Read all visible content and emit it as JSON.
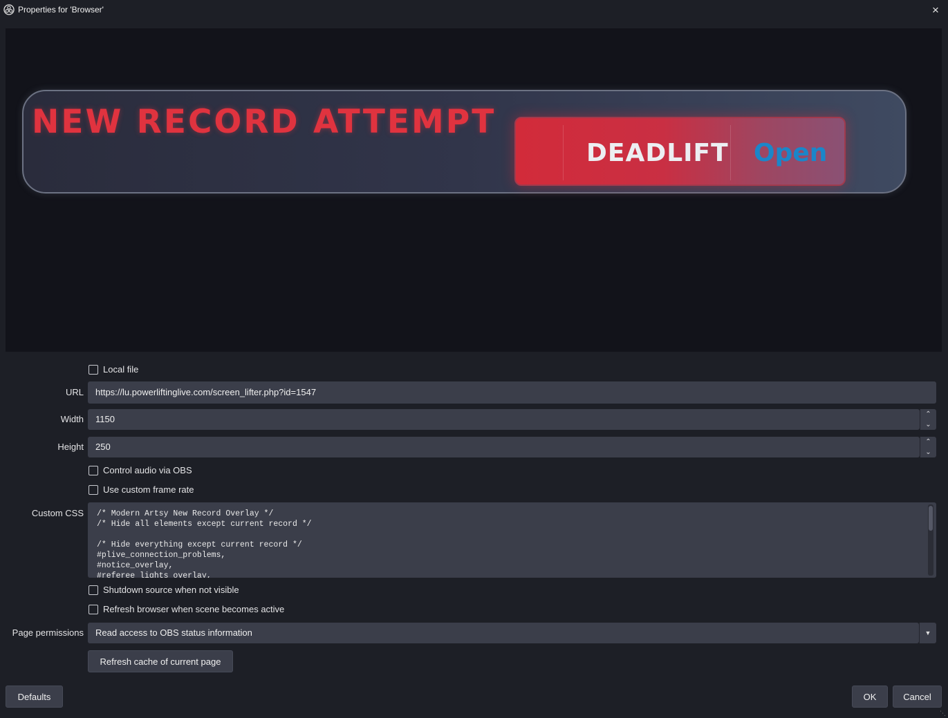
{
  "window": {
    "title": "Properties for 'Browser'",
    "icon": "obs-logo-icon",
    "close_icon": "×"
  },
  "preview": {
    "banner_title": "NEW RECORD ATTEMPT",
    "lift_name": "DEADLIFT",
    "lift_status": "Open",
    "colors": {
      "accent_red": "#e0333f",
      "status_blue": "#1b86c9",
      "background": "#12131a"
    }
  },
  "form": {
    "local_file": {
      "label": "Local file",
      "checked": false
    },
    "url": {
      "label": "URL",
      "value": "https://lu.powerliftinglive.com/screen_lifter.php?id=1547"
    },
    "width": {
      "label": "Width",
      "value": "1150"
    },
    "height": {
      "label": "Height",
      "value": "250"
    },
    "control_audio": {
      "label": "Control audio via OBS",
      "checked": false
    },
    "custom_frame_rate": {
      "label": "Use custom frame rate",
      "checked": false
    },
    "custom_css": {
      "label": "Custom CSS",
      "value": "/* Modern Artsy New Record Overlay */\n/* Hide all elements except current record */\n\n/* Hide everything except current record */\n#plive_connection_problems,\n#notice_overlay,\n#referee_lights_overlay,"
    },
    "shutdown_source": {
      "label": "Shutdown source when not visible",
      "checked": false
    },
    "refresh_browser": {
      "label": "Refresh browser when scene becomes active",
      "checked": false
    },
    "page_permissions": {
      "label": "Page permissions",
      "value": "Read access to OBS status information"
    },
    "refresh_cache_label": "Refresh cache of current page"
  },
  "footer": {
    "defaults_label": "Defaults",
    "ok_label": "OK",
    "cancel_label": "Cancel"
  }
}
